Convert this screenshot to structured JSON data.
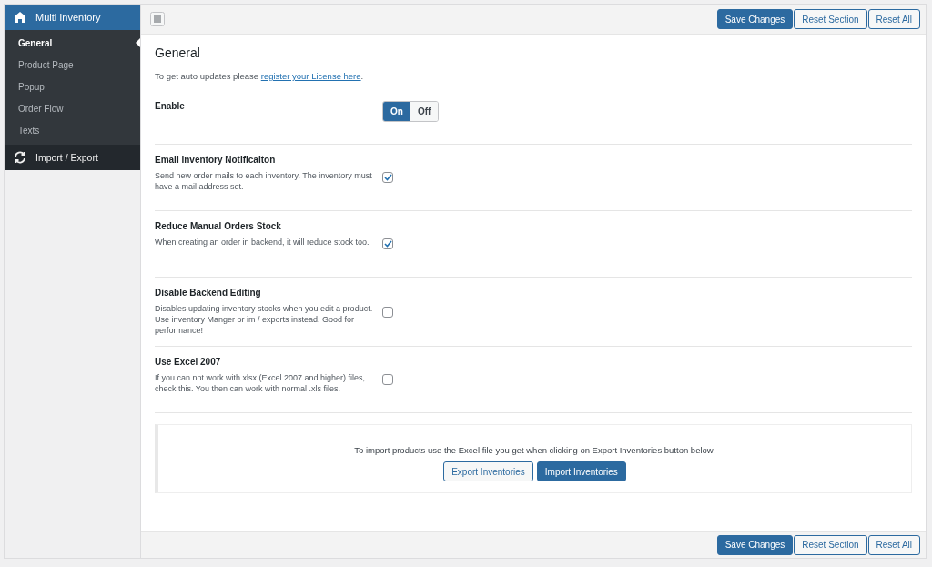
{
  "sidebar": {
    "header": {
      "label": "Multi Inventory"
    },
    "items": [
      {
        "label": "General",
        "selected": true
      },
      {
        "label": "Product Page",
        "selected": false
      },
      {
        "label": "Popup",
        "selected": false
      },
      {
        "label": "Order Flow",
        "selected": false
      },
      {
        "label": "Texts",
        "selected": false
      }
    ],
    "section": {
      "label": "Import / Export"
    }
  },
  "top_bar": {
    "buttons": [
      {
        "label": "Save Changes",
        "kind": "primary"
      },
      {
        "label": "Reset Section",
        "kind": "secondary"
      },
      {
        "label": "Reset All",
        "kind": "secondary"
      }
    ]
  },
  "content": {
    "title": "General",
    "intro": "To get auto updates please ",
    "intro_link": "register your License here",
    "intro_end": ".",
    "settings": [
      {
        "kind": "toggle",
        "label": "Enable",
        "options": [
          {
            "label": "On",
            "selected": true
          },
          {
            "label": "Off",
            "selected": false
          }
        ]
      },
      {
        "kind": "checkbox",
        "label": "Email Inventory Notificaiton",
        "description": "Send new order mails to each inventory. The inventory must have a mail address set.",
        "checked": true
      },
      {
        "kind": "checkbox",
        "label": "Reduce Manual Orders Stock",
        "description": "When creating an order in backend, it will reduce stock too.",
        "checked": true
      },
      {
        "kind": "checkbox",
        "label": "Disable Backend Editing",
        "description": "Disables updating inventory stocks when you edit a product. Use inventory Manger or im / exports instead. Good for performance!",
        "checked": false
      },
      {
        "kind": "checkbox",
        "label": "Use Excel 2007",
        "description": "If you can not work with xlsx (Excel 2007 and higher) files, check this. You then can work with normal .xls files.",
        "checked": false
      }
    ],
    "import_box": {
      "text": "To import products use the Excel file you get when clicking on Export Inventories button below.",
      "buttons": [
        {
          "label": "Export Inventories",
          "kind": "secondary"
        },
        {
          "label": "Import Inventories",
          "kind": "primary"
        }
      ]
    }
  },
  "bottom_bar": {
    "buttons": [
      {
        "label": "Save Changes",
        "kind": "primary"
      },
      {
        "label": "Reset Section",
        "kind": "secondary"
      },
      {
        "label": "Reset All",
        "kind": "secondary"
      }
    ]
  }
}
